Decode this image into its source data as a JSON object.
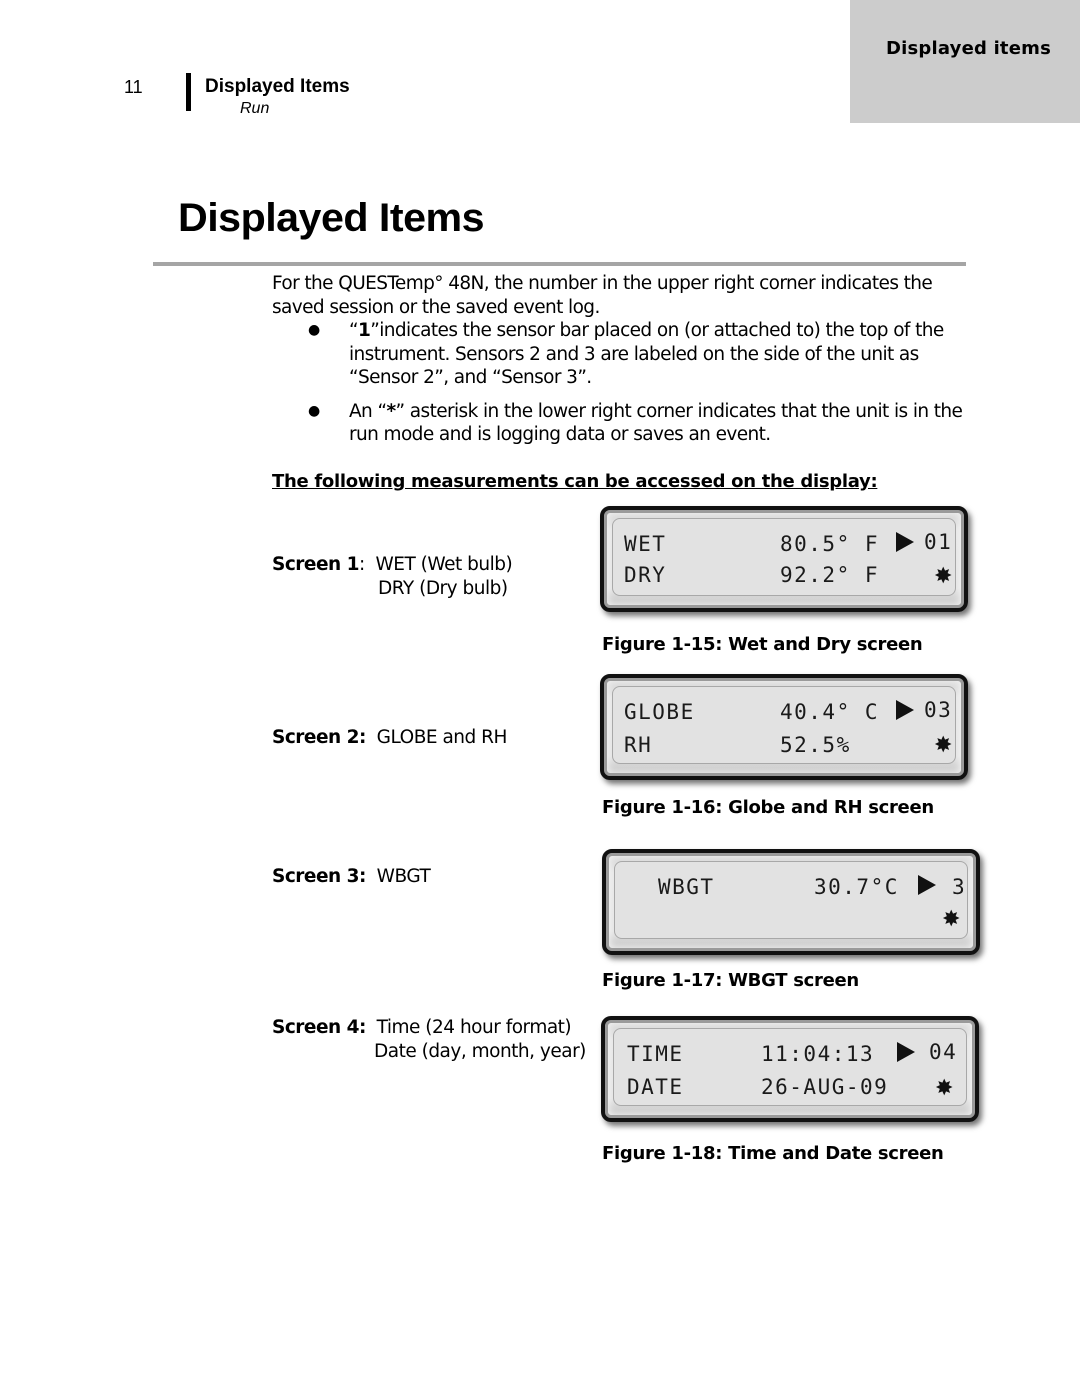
{
  "header": {
    "page_number": "11",
    "title": "Displayed Items",
    "subtitle": "Run",
    "tab_label": "Displayed items"
  },
  "page_title": "Displayed Items",
  "intro": "For the QUESTemp° 48N, the number in the upper right corner indicates the saved session or the saved event log.",
  "bullets": [
    {
      "bold_prefix_open": "“",
      "bold": "1",
      "text": "”indicates the sensor bar placed on (or attached to) the top of the instrument.  Sensors 2 and 3 are labeled on the side of the unit as “Sensor 2”, and “Sensor 3”."
    },
    {
      "bold_prefix_open": " An “",
      "bold": "*",
      "text": "” asterisk in the lower right corner indicates that the unit is in the run mode and is logging data or saves an event."
    }
  ],
  "sub_heading": "The following measurements can be accessed on the display:",
  "screens": [
    {
      "label": "Screen 1",
      "sep": ":  ",
      "desc_lines": [
        "WET (Wet bulb)",
        "DRY (Dry bulb)"
      ],
      "lcd": {
        "row1_label": "WET",
        "row1_value": "80.5° F",
        "session": "01",
        "row2_label": "DRY",
        "row2_value": "92.2° F"
      },
      "caption": "Figure 1-15: Wet and Dry screen"
    },
    {
      "label": "Screen 2:",
      "sep": "  ",
      "desc_lines": [
        "GLOBE and RH"
      ],
      "lcd": {
        "row1_label": "GLOBE",
        "row1_value": "40.4° C",
        "session": "03",
        "row2_label": "RH",
        "row2_value": "52.5%"
      },
      "caption": "Figure 1-16: Globe and RH screen"
    },
    {
      "label": "Screen 3:",
      "sep": "  ",
      "desc_lines": [
        "WBGT"
      ],
      "lcd": {
        "row1_label": "WBGT",
        "row1_value": "30.7°C",
        "session": "3"
      },
      "caption": "Figure 1-17: WBGT screen"
    },
    {
      "label": "Screen 4:",
      "sep": "  ",
      "desc_lines": [
        "Time (24 hour format)",
        "Date (day, month, year)"
      ],
      "lcd": {
        "row1_label": "TIME",
        "row1_value": "11:04:13",
        "session": "04",
        "row2_label": "DATE",
        "row2_value": "26-AUG-09"
      },
      "caption": "Figure 1-18:  Time and Date screen"
    }
  ],
  "icons": {
    "arrow": "play-arrow-icon",
    "star": "logging-asterisk-icon",
    "star_glyph": "✸"
  }
}
